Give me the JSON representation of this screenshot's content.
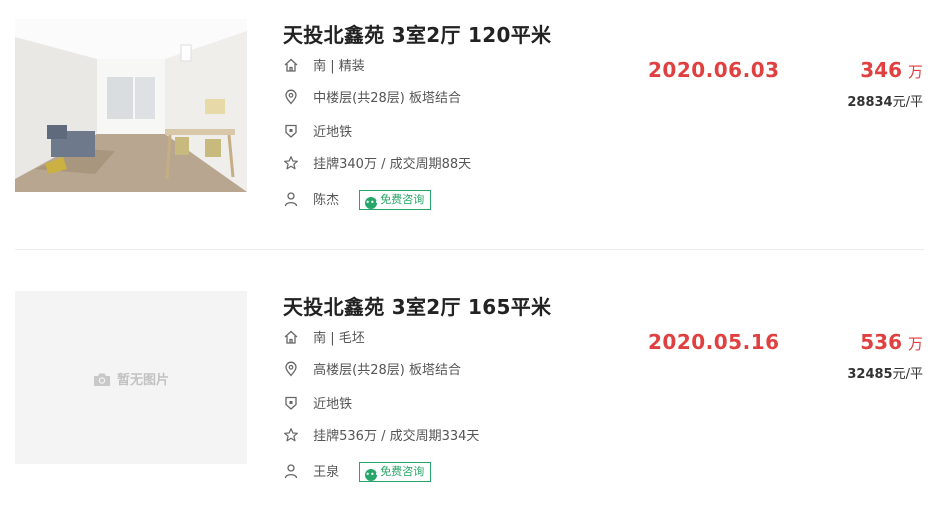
{
  "listings": [
    {
      "title": "天投北鑫苑 3室2厅 120平米",
      "orientation_decoration": "南 | 精装",
      "floor_info": "中楼层(共28层) 板塔结合",
      "tag": "近地铁",
      "listing_info": "挂牌340万 / 成交周期88天",
      "agent": "陈杰",
      "consult_label": "免费咨询",
      "deal_date": "2020.06.03",
      "total_price": "346",
      "total_unit": "万",
      "unit_price": "28834",
      "unit_price_suffix": "元/平",
      "has_photo": true
    },
    {
      "title": "天投北鑫苑 3室2厅 165平米",
      "orientation_decoration": "南 | 毛坯",
      "floor_info": "高楼层(共28层) 板塔结合",
      "tag": "近地铁",
      "listing_info": "挂牌536万 / 成交周期334天",
      "agent": "王泉",
      "consult_label": "免费咨询",
      "deal_date": "2020.05.16",
      "total_price": "536",
      "total_unit": "万",
      "unit_price": "32485",
      "unit_price_suffix": "元/平",
      "has_photo": false,
      "no_photo_text": "暂无图片"
    }
  ],
  "colors": {
    "accent_red": "#e04040",
    "consult_green": "#26a668"
  },
  "icons": [
    "home-icon",
    "location-pin-icon",
    "shield-tag-icon",
    "star-icon",
    "person-icon",
    "chat-bubble-icon",
    "camera-icon"
  ]
}
